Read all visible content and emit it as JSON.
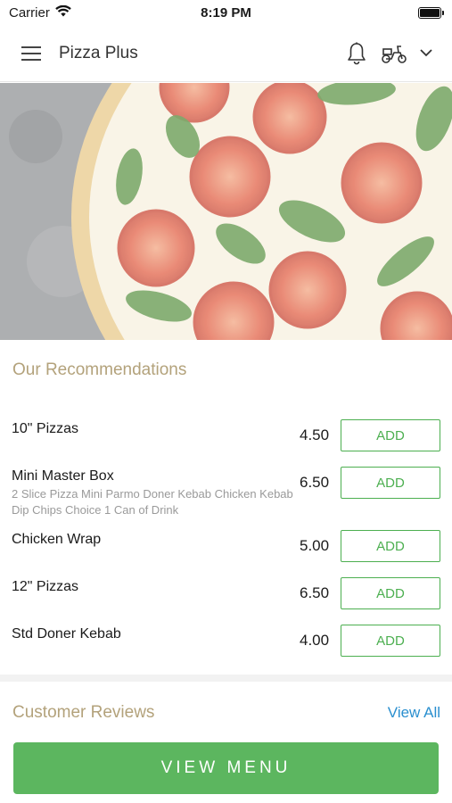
{
  "status_bar": {
    "carrier": "Carrier",
    "time": "8:19 PM"
  },
  "header": {
    "title": "Pizza Plus",
    "icons": {
      "menu": "hamburger-menu-icon",
      "bell": "bell-icon",
      "delivery": "scooter-icon",
      "dropdown": "chevron-down-icon"
    }
  },
  "hero": {
    "image": "margherita-pizza-photo"
  },
  "recommendations": {
    "title": "Our Recommendations",
    "add_label": "ADD",
    "items": [
      {
        "name": "10\" Pizzas",
        "desc": "",
        "price": "4.50"
      },
      {
        "name": "Mini Master Box",
        "desc": "2 Slice Pizza  Mini Parmo  Doner Kebab  Chicken Kebab  Dip  Chips  Choice 1 Can of Drink",
        "price": "6.50"
      },
      {
        "name": "Chicken Wrap",
        "desc": "",
        "price": "5.00"
      },
      {
        "name": "12\" Pizzas",
        "desc": "",
        "price": "6.50"
      },
      {
        "name": "Std Doner Kebab",
        "desc": "",
        "price": "4.00"
      }
    ]
  },
  "reviews": {
    "title": "Customer Reviews",
    "view_all": "View All"
  },
  "footer": {
    "view_menu": "VIEW MENU"
  },
  "colors": {
    "accent_green": "#5cb65f",
    "section_title": "#b3a27b",
    "link_blue": "#2a8fcf"
  }
}
